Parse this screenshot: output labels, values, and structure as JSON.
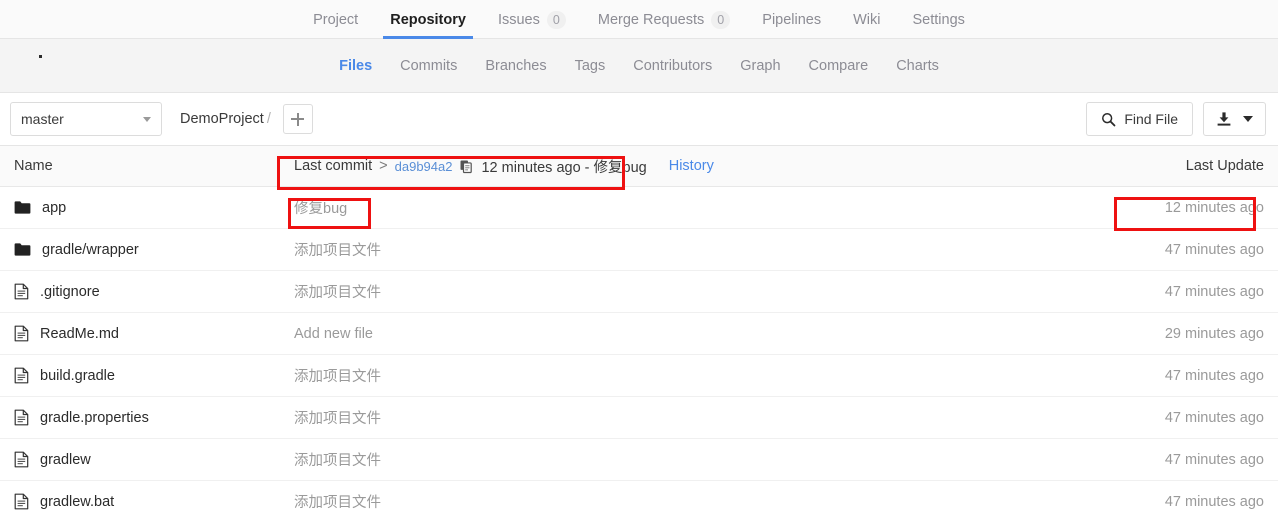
{
  "top_nav": {
    "items": [
      {
        "label": "Project",
        "badge": null,
        "active": false
      },
      {
        "label": "Repository",
        "badge": null,
        "active": true
      },
      {
        "label": "Issues",
        "badge": "0",
        "active": false
      },
      {
        "label": "Merge Requests",
        "badge": "0",
        "active": false
      },
      {
        "label": "Pipelines",
        "badge": null,
        "active": false
      },
      {
        "label": "Wiki",
        "badge": null,
        "active": false
      },
      {
        "label": "Settings",
        "badge": null,
        "active": false
      }
    ]
  },
  "sub_nav": {
    "items": [
      {
        "label": "Files",
        "active": true
      },
      {
        "label": "Commits",
        "active": false
      },
      {
        "label": "Branches",
        "active": false
      },
      {
        "label": "Tags",
        "active": false
      },
      {
        "label": "Contributors",
        "active": false
      },
      {
        "label": "Graph",
        "active": false
      },
      {
        "label": "Compare",
        "active": false
      },
      {
        "label": "Charts",
        "active": false
      }
    ]
  },
  "toolbar": {
    "branch": "master",
    "breadcrumb_project": "DemoProject",
    "breadcrumb_separator": "/",
    "add_label": "+",
    "find_file_label": "Find File",
    "download_label": ""
  },
  "table": {
    "header": {
      "name": "Name",
      "last_update": "Last Update"
    },
    "commit_bar": {
      "prefix": "Last commit",
      "arrow": ">",
      "sha": "da9b94a2",
      "meta": "12 minutes ago - 修复bug",
      "history_label": "History"
    },
    "rows": [
      {
        "icon": "folder",
        "name": "app",
        "commit": "修复bug",
        "updated": "12 minutes ago"
      },
      {
        "icon": "folder",
        "name": "gradle/wrapper",
        "commit": "添加项目文件",
        "updated": "47 minutes ago"
      },
      {
        "icon": "file",
        "name": ".gitignore",
        "commit": "添加项目文件",
        "updated": "47 minutes ago"
      },
      {
        "icon": "file",
        "name": "ReadMe.md",
        "commit": "Add new file",
        "updated": "29 minutes ago"
      },
      {
        "icon": "file",
        "name": "build.gradle",
        "commit": "添加项目文件",
        "updated": "47 minutes ago"
      },
      {
        "icon": "file",
        "name": "gradle.properties",
        "commit": "添加项目文件",
        "updated": "47 minutes ago"
      },
      {
        "icon": "file",
        "name": "gradlew",
        "commit": "添加项目文件",
        "updated": "47 minutes ago"
      },
      {
        "icon": "file",
        "name": "gradlew.bat",
        "commit": "添加项目文件",
        "updated": "47 minutes ago"
      }
    ]
  },
  "colors": {
    "accent_blue": "#4a89e8",
    "link_blue": "#5a8fd6",
    "annotation_red": "#ee1111",
    "muted_text": "#9a9a9a"
  }
}
